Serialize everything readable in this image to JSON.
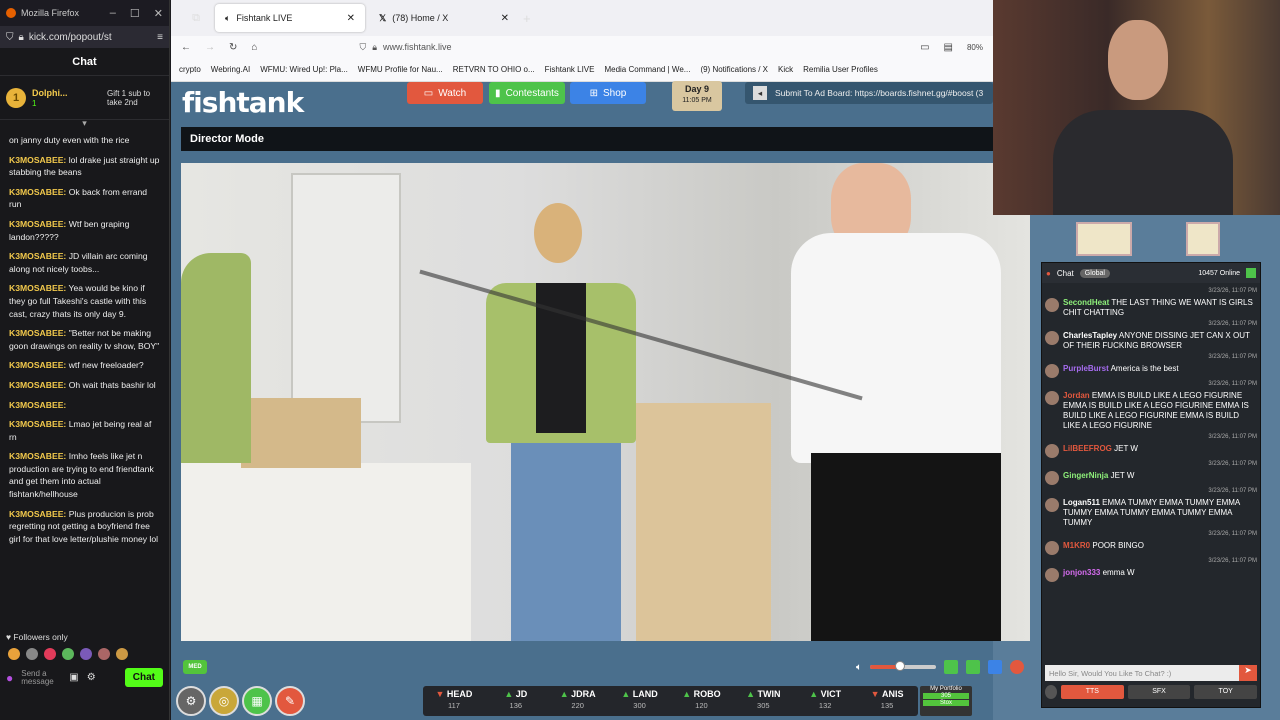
{
  "left_window": {
    "title": "Mozilla Firefox",
    "url": "kick.com/popout/st",
    "chat_title": "Chat",
    "pinned": {
      "badge": "1",
      "name": "Dolphi...",
      "level": "1",
      "gift": "Gift 1 sub to take 2nd"
    },
    "messages": [
      {
        "user": "",
        "text": "on janny duty even with the rice"
      },
      {
        "user": "K3MOSABEE:",
        "text": "lol drake just straight up stabbing the beans"
      },
      {
        "user": "K3MOSABEE:",
        "text": "Ok back from errand run"
      },
      {
        "user": "K3MOSABEE:",
        "text": "Wtf ben graping landon?????"
      },
      {
        "user": "K3MOSABEE:",
        "text": "JD villain arc coming along not nicely toobs..."
      },
      {
        "user": "K3MOSABEE:",
        "text": "Yea would be kino if they go full Takeshi's castle with this cast, crazy thats its only day 9."
      },
      {
        "user": "K3MOSABEE:",
        "text": "\"Better not be making goon drawings on reality tv show, BOY\""
      },
      {
        "user": "K3MOSABEE:",
        "text": "wtf new freeloader?"
      },
      {
        "user": "K3MOSABEE:",
        "text": "Oh wait thats bashir lol"
      },
      {
        "user": "K3MOSABEE:",
        "text": ""
      },
      {
        "user": "K3MOSABEE:",
        "text": "Lmao jet being real af rn"
      },
      {
        "user": "K3MOSABEE:",
        "text": "Imho feels like jet n production are trying to end friendtank and get them into actual fishtank/hellhouse"
      },
      {
        "user": "K3MOSABEE:",
        "text": "Plus producion is prob regretting not getting a boyfriend free girl for that love letter/plushie money lol"
      }
    ],
    "followers_only": "Followers only",
    "send_placeholder": "Send a message",
    "chat_button": "Chat"
  },
  "browser": {
    "tabs": [
      {
        "label": "Fishtank LIVE"
      },
      {
        "label": "(78) Home / X"
      }
    ],
    "url": "www.fishtank.live",
    "zoom": "80%",
    "bookmarks": [
      "crypto",
      "Webring.AI",
      "WFMU: Wired Up!: Pla...",
      "WFMU Profile for Nau...",
      "RETVRN TO OHIO o...",
      "Fishtank LIVE",
      "Media Command | We...",
      "(9) Notifications / X",
      "Kick",
      "Remilia User Profiles"
    ]
  },
  "site": {
    "logo": "fishtank",
    "nav": {
      "watch": "Watch",
      "contestants": "Contestants",
      "shop": "Shop"
    },
    "day": "Day 9",
    "time": "11:05 PM",
    "ad_board": "Submit To Ad Board: https://boards.fishnet.gg/#boost (3",
    "mode": "Director Mode",
    "quality": "MED",
    "poll": [
      {
        "name": "HEAD",
        "val": "117",
        "dir": "down"
      },
      {
        "name": "JD",
        "val": "136",
        "dir": "up"
      },
      {
        "name": "JDRA",
        "val": "220",
        "dir": "up"
      },
      {
        "name": "LAND",
        "val": "300",
        "dir": "up"
      },
      {
        "name": "ROBO",
        "val": "120",
        "dir": "up"
      },
      {
        "name": "TWIN",
        "val": "305",
        "dir": "up"
      },
      {
        "name": "VICT",
        "val": "132",
        "dir": "up"
      },
      {
        "name": "ANIS",
        "val": "135",
        "dir": "down"
      }
    ],
    "portfolio": {
      "label": "My Portfolio",
      "value": "305",
      "button": "Stox"
    },
    "volume": 0.45,
    "colors": {
      "watch": "#e2583e",
      "contestants": "#4ec34a",
      "shop": "#3c83e6"
    }
  },
  "side_chat": {
    "tab": "Chat",
    "global": "Global",
    "online": "10457 Online",
    "messages": [
      {
        "time": "3/23/26, 11:07 PM",
        "user": "SecondHeat",
        "text": "THE LAST THING WE WANT IS GIRLS CHIT CHATTING",
        "color": "#8ef07a"
      },
      {
        "time": "3/23/26, 11:07 PM",
        "user": "CharlesTapley",
        "text": "ANYONE DISSING JET CAN X OUT OF THEIR FUCKING BROWSER",
        "color": "#ffffff"
      },
      {
        "time": "3/23/26, 11:07 PM",
        "user": "PurpleBurst",
        "text": "America is the best",
        "color": "#a66cf0"
      },
      {
        "time": "3/23/26, 11:07 PM",
        "user": "Jordan",
        "text": "EMMA IS BUILD LIKE A LEGO FIGURINE EMMA IS BUILD LIKE A LEGO FIGURINE EMMA IS BUILD LIKE A LEGO FIGURINE EMMA IS BUILD LIKE A LEGO FIGURINE",
        "color": "#e2583e"
      },
      {
        "time": "3/23/26, 11:07 PM",
        "user": "LilBEEFROG",
        "text": "JET W",
        "color": "#e2583e"
      },
      {
        "time": "3/23/26, 11:07 PM",
        "user": "GingerNinja",
        "text": "JET W",
        "color": "#8ef07a"
      },
      {
        "time": "3/23/26, 11:07 PM",
        "user": "Logan511",
        "text": "EMMA TUMMY EMMA TUMMY EMMA TUMMY EMMA TUMMY EMMA TUMMY EMMA TUMMY",
        "color": "#ffffff"
      },
      {
        "time": "3/23/26, 11:07 PM",
        "user": "M1KR0",
        "text": "POOR BINGO",
        "color": "#e2583e"
      },
      {
        "time": "3/23/26, 11:07 PM",
        "user": "jonjon333",
        "text": "emma W",
        "color": "#d66cf0"
      }
    ],
    "input_placeholder": "Hello Sir, Would You Like To Chat? :)",
    "tts": "TTS",
    "sfx": "SFX",
    "toy": "TOY"
  }
}
